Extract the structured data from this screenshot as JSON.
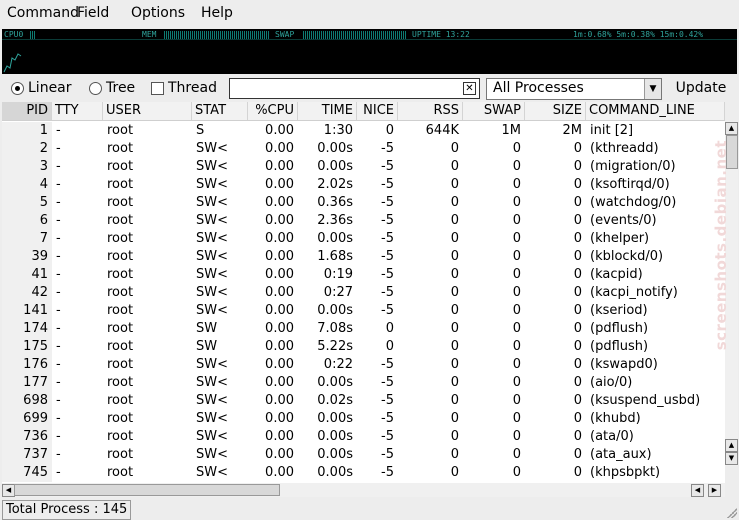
{
  "menu": [
    "Command",
    "Field",
    "Options",
    "Help"
  ],
  "monitor": {
    "cpu_label": "CPU0",
    "mem_label": "MEM",
    "swap_label": "SWAP",
    "uptime": "UPTIME 13:22",
    "load": "1m:0.68% 5m:0.38% 15m:0.42%"
  },
  "toolbar": {
    "view_options": [
      "Linear",
      "Tree"
    ],
    "selected_view": "Linear",
    "thread_label": "Thread",
    "thread_checked": false,
    "search_value": "",
    "filter_value": "All Processes",
    "update_label": "Update"
  },
  "columns": [
    "PID",
    "TTY",
    "USER",
    "STAT",
    "%CPU",
    "TIME",
    "NICE",
    "RSS",
    "SWAP",
    "SIZE",
    "COMMAND_LINE"
  ],
  "sorted_column": "PID",
  "rows": [
    [
      "1",
      "-",
      "root",
      "S",
      "0.00",
      "1:30",
      "0",
      "644K",
      "1M",
      "2M",
      "init [2]"
    ],
    [
      "2",
      "-",
      "root",
      "SW<",
      "0.00",
      "0.00s",
      "-5",
      "0",
      "0",
      "0",
      "(kthreadd)"
    ],
    [
      "3",
      "-",
      "root",
      "SW<",
      "0.00",
      "0.00s",
      "-5",
      "0",
      "0",
      "0",
      "(migration/0)"
    ],
    [
      "4",
      "-",
      "root",
      "SW<",
      "0.00",
      "2.02s",
      "-5",
      "0",
      "0",
      "0",
      "(ksoftirqd/0)"
    ],
    [
      "5",
      "-",
      "root",
      "SW<",
      "0.00",
      "0.36s",
      "-5",
      "0",
      "0",
      "0",
      "(watchdog/0)"
    ],
    [
      "6",
      "-",
      "root",
      "SW<",
      "0.00",
      "2.36s",
      "-5",
      "0",
      "0",
      "0",
      "(events/0)"
    ],
    [
      "7",
      "-",
      "root",
      "SW<",
      "0.00",
      "0.00s",
      "-5",
      "0",
      "0",
      "0",
      "(khelper)"
    ],
    [
      "39",
      "-",
      "root",
      "SW<",
      "0.00",
      "1.68s",
      "-5",
      "0",
      "0",
      "0",
      "(kblockd/0)"
    ],
    [
      "41",
      "-",
      "root",
      "SW<",
      "0.00",
      "0:19",
      "-5",
      "0",
      "0",
      "0",
      "(kacpid)"
    ],
    [
      "42",
      "-",
      "root",
      "SW<",
      "0.00",
      "0:27",
      "-5",
      "0",
      "0",
      "0",
      "(kacpi_notify)"
    ],
    [
      "141",
      "-",
      "root",
      "SW<",
      "0.00",
      "0.00s",
      "-5",
      "0",
      "0",
      "0",
      "(kseriod)"
    ],
    [
      "174",
      "-",
      "root",
      "SW",
      "0.00",
      "7.08s",
      "0",
      "0",
      "0",
      "0",
      "(pdflush)"
    ],
    [
      "175",
      "-",
      "root",
      "SW",
      "0.00",
      "5.22s",
      "0",
      "0",
      "0",
      "0",
      "(pdflush)"
    ],
    [
      "176",
      "-",
      "root",
      "SW<",
      "0.00",
      "0:22",
      "-5",
      "0",
      "0",
      "0",
      "(kswapd0)"
    ],
    [
      "177",
      "-",
      "root",
      "SW<",
      "0.00",
      "0.00s",
      "-5",
      "0",
      "0",
      "0",
      "(aio/0)"
    ],
    [
      "698",
      "-",
      "root",
      "SW<",
      "0.00",
      "0.02s",
      "-5",
      "0",
      "0",
      "0",
      "(ksuspend_usbd)"
    ],
    [
      "699",
      "-",
      "root",
      "SW<",
      "0.00",
      "0.00s",
      "-5",
      "0",
      "0",
      "0",
      "(khubd)"
    ],
    [
      "736",
      "-",
      "root",
      "SW<",
      "0.00",
      "0.00s",
      "-5",
      "0",
      "0",
      "0",
      "(ata/0)"
    ],
    [
      "737",
      "-",
      "root",
      "SW<",
      "0.00",
      "0.00s",
      "-5",
      "0",
      "0",
      "0",
      "(ata_aux)"
    ],
    [
      "745",
      "-",
      "root",
      "SW<",
      "0.00",
      "0.00s",
      "-5",
      "0",
      "0",
      "0",
      "(khpsbpkt)"
    ]
  ],
  "status": "Total Process : 145",
  "watermark": "screenshots.debian.net",
  "colors": {
    "monitor_bg": "#000000",
    "monitor_text": "#2fa39b",
    "meter": "#0e7c72"
  },
  "icons": {
    "clear": "clear-search-icon",
    "dropdown": "chevron-down-icon"
  }
}
